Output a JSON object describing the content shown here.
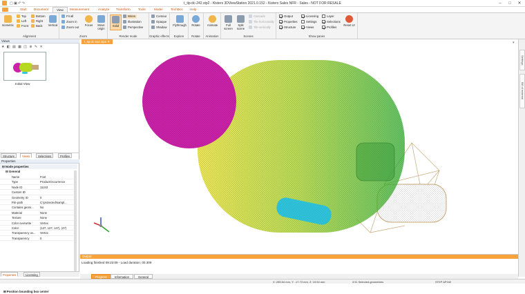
{
  "window": {
    "title": "t_tip-dc-242.stp2 - Kisters 3DViewStation 2021.0.152 - Kisters Sales NFR - Sales - NOT FOR RESALE"
  },
  "menu": {
    "tabs": [
      "Start",
      "Document",
      "View",
      "Measurement",
      "Analyze",
      "Transform",
      "Tools",
      "Model",
      "TechDoc",
      "Help"
    ],
    "active": "View"
  },
  "ribbon": {
    "alignment": {
      "label": "Alignment",
      "isometric": "Isometric",
      "items": [
        "Top",
        "Bottom",
        "Left",
        "Right",
        "Front",
        "Back"
      ],
      "vertical": "Vertical"
    },
    "zoom": {
      "label": "Zoom",
      "items": [
        "Fit all",
        "Zoom in",
        "Zoom out"
      ],
      "focus": "Focus",
      "move_origin": "Move origin"
    },
    "render": {
      "label": "Render mode",
      "solid": "Solid",
      "items": [
        "Wires",
        "Illustration",
        "Perspective"
      ]
    },
    "effects": {
      "label": "Graphic effects",
      "items": [
        "Contour",
        "Opaque",
        "Shadow"
      ]
    },
    "explore": {
      "label": "Explore",
      "btn": "Flythrough"
    },
    "rotate": {
      "label": "Rotate",
      "btn": "Rotate"
    },
    "animation": {
      "label": "Animation",
      "btn": "Animate"
    },
    "scenes": {
      "label": "Scenes",
      "full": "Full screen",
      "split": "Split scene",
      "items": [
        "Cascade",
        "Tile horizontally",
        "Tile vertically"
      ]
    },
    "panes": {
      "label": "Show panes",
      "col1": [
        "Output",
        "Properties",
        "Structure"
      ],
      "col2": [
        "Licensing",
        "Settings",
        "Views"
      ],
      "col3": [
        "Layer",
        "Selections",
        "Profiles"
      ],
      "reset": "Reset UI"
    }
  },
  "views_panel": {
    "title": "Views",
    "thumb_label": "Initial View",
    "tabs": [
      "Structure",
      "Views",
      "Selections",
      "Profiles"
    ],
    "active_tab": "Views"
  },
  "properties_panel": {
    "title": "Properties",
    "section": "Node properties",
    "group": "General",
    "rows": [
      {
        "key": "Name",
        "value": "Foot"
      },
      {
        "key": "Type",
        "value": "ProductOccurrence"
      },
      {
        "key": "Node ID",
        "value": "11243"
      },
      {
        "key": "Custom ID",
        "value": ""
      },
      {
        "key": "Geometry ID",
        "value": "0"
      },
      {
        "key": "File path",
        "value": "C:\\protected\\sampl..."
      },
      {
        "key": "Contains geom...",
        "value": "No"
      },
      {
        "key": "Material",
        "value": "None"
      },
      {
        "key": "Texture",
        "value": "None"
      },
      {
        "key": "Color overwrite",
        "value": "Vertex"
      },
      {
        "key": "Color",
        "value": "(127, 127, 127), (47)"
      },
      {
        "key": "Transparency ov...",
        "value": "Vertex"
      },
      {
        "key": "Transparency",
        "value": "0"
      }
    ],
    "footer_group": "Position bounding box center",
    "tabs": [
      "Properties",
      "Licensing"
    ],
    "active_tab": "Properties"
  },
  "document_tab": "t_tip-dc-242.stp2",
  "right_tabs": [
    "Settings",
    "Bill of material"
  ],
  "output": {
    "title": "Output",
    "message": "Loading finished 09:23:09 - Load duration: 00.309"
  },
  "bottom_tabs": [
    "Progress",
    "Information",
    "General"
  ],
  "bottom_active": "Progress",
  "status": {
    "coords": "X: 255.54 mm, Y: -17.73 mm, Z: 19.54 mm",
    "selected": "2/11 Selected geometries",
    "mode": "STEP AP242"
  },
  "colors": {
    "accent": "#f7a23a",
    "sphere": "#cc22aa",
    "capsule_start": "#e8e020",
    "capsule_end": "#30b030",
    "small_cyl": "#30c8e0",
    "wire": "#c8a878"
  }
}
